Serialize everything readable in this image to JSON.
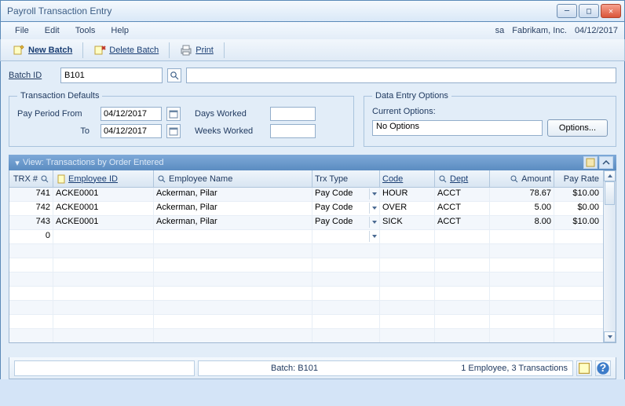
{
  "window": {
    "title": "Payroll Transaction Entry"
  },
  "menubar": {
    "file": "File",
    "edit": "Edit",
    "tools": "Tools",
    "help": "Help"
  },
  "session": {
    "user": "sa",
    "company": "Fabrikam, Inc.",
    "date": "04/12/2017"
  },
  "toolbar": {
    "new_batch": "New Batch",
    "delete_batch": "Delete Batch",
    "print": "Print"
  },
  "batch": {
    "label": "Batch ID",
    "value": "B101"
  },
  "defaults": {
    "legend": "Transaction Defaults",
    "pay_period_from_lbl": "Pay Period From",
    "pay_period_to_lbl": "To",
    "pay_period_from": "04/12/2017",
    "pay_period_to": "04/12/2017",
    "days_worked_lbl": "Days Worked",
    "weeks_worked_lbl": "Weeks Worked",
    "days_worked": "",
    "weeks_worked": ""
  },
  "options": {
    "legend": "Data Entry Options",
    "current_lbl": "Current Options:",
    "current_value": "No Options",
    "button": "Options..."
  },
  "viewbar": {
    "caption": "View:  Transactions  by Order Entered"
  },
  "grid": {
    "headers": {
      "trx": "TRX #",
      "emp_id": "Employee ID",
      "emp_name": "Employee Name",
      "trx_type": "Trx Type",
      "code": "Code",
      "dept": "Dept",
      "amount": "Amount",
      "rate": "Pay Rate"
    },
    "rows": [
      {
        "trx": "741",
        "emp_id": "ACKE0001",
        "emp_name": "Ackerman, Pilar",
        "trx_type": "Pay Code",
        "code": "HOUR",
        "dept": "ACCT",
        "amount": "78.67",
        "rate": "$10.00"
      },
      {
        "trx": "742",
        "emp_id": "ACKE0001",
        "emp_name": "Ackerman, Pilar",
        "trx_type": "Pay Code",
        "code": "OVER",
        "dept": "ACCT",
        "amount": "5.00",
        "rate": "$0.00"
      },
      {
        "trx": "743",
        "emp_id": "ACKE0001",
        "emp_name": "Ackerman, Pilar",
        "trx_type": "Pay Code",
        "code": "SICK",
        "dept": "ACCT",
        "amount": "8.00",
        "rate": "$10.00"
      },
      {
        "trx": "0",
        "emp_id": "",
        "emp_name": "",
        "trx_type": "",
        "code": "",
        "dept": "",
        "amount": "",
        "rate": ""
      }
    ]
  },
  "status": {
    "batch": "Batch: B101",
    "summary": "1 Employee, 3 Transactions"
  }
}
